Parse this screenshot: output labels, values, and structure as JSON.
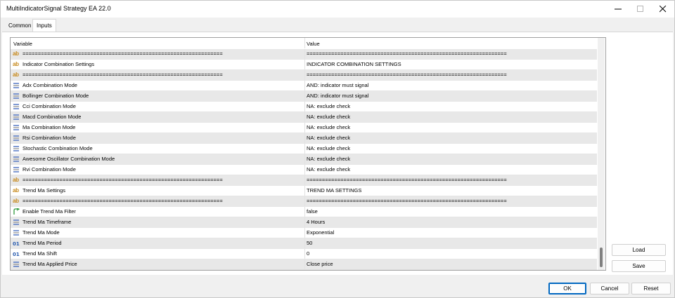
{
  "window": {
    "title": "MultiIndicatorSignal Strategy EA 22.0"
  },
  "tabs": [
    {
      "label": "Common"
    },
    {
      "label": "Inputs"
    }
  ],
  "grid": {
    "headers": {
      "variable": "Variable",
      "value": "Value"
    },
    "rows": [
      {
        "icon": "ab-icon",
        "variable": "=================================================================",
        "value": "================================================================="
      },
      {
        "icon": "ab-icon",
        "variable": "Indicator Combination Settings",
        "value": "INDICATOR COMBINATION SETTINGS"
      },
      {
        "icon": "ab-icon",
        "variable": "=================================================================",
        "value": "================================================================="
      },
      {
        "icon": "enum-icon",
        "variable": "Adx Combination Mode",
        "value": "AND: indicator must signal"
      },
      {
        "icon": "enum-icon",
        "variable": "Bollinger Combination Mode",
        "value": "AND: indicator must signal"
      },
      {
        "icon": "enum-icon",
        "variable": "Cci Combination Mode",
        "value": "NA: exclude check"
      },
      {
        "icon": "enum-icon",
        "variable": "Macd Combination Mode",
        "value": "NA: exclude check"
      },
      {
        "icon": "enum-icon",
        "variable": "Ma Combination Mode",
        "value": "NA: exclude check"
      },
      {
        "icon": "enum-icon",
        "variable": "Rsi Combination Mode",
        "value": "NA: exclude check"
      },
      {
        "icon": "enum-icon",
        "variable": "Stochastic Combination Mode",
        "value": "NA: exclude check"
      },
      {
        "icon": "enum-icon",
        "variable": "Awesome Oscillator Combination Mode",
        "value": "NA: exclude check"
      },
      {
        "icon": "enum-icon",
        "variable": "Rvi Combination Mode",
        "value": "NA: exclude check"
      },
      {
        "icon": "ab-icon",
        "variable": "=================================================================",
        "value": "================================================================="
      },
      {
        "icon": "ab-icon",
        "variable": "Trend Ma Settings",
        "value": "TREND MA SETTINGS"
      },
      {
        "icon": "ab-icon",
        "variable": "=================================================================",
        "value": "================================================================="
      },
      {
        "icon": "bool-icon",
        "variable": "Enable Trend Ma Filter",
        "value": "false"
      },
      {
        "icon": "enum-icon",
        "variable": "Trend Ma Timeframe",
        "value": "4 Hours"
      },
      {
        "icon": "enum-icon",
        "variable": "Trend Ma Mode",
        "value": "Exponential"
      },
      {
        "icon": "int-icon",
        "variable": "Trend Ma Period",
        "value": "50"
      },
      {
        "icon": "int-icon",
        "variable": "Trend Ma Shift",
        "value": "0"
      },
      {
        "icon": "enum-icon",
        "variable": "Trend Ma Applied Price",
        "value": "Close price"
      }
    ]
  },
  "side_buttons": {
    "load": "Load",
    "save": "Save"
  },
  "footer_buttons": {
    "ok": "OK",
    "cancel": "Cancel",
    "reset": "Reset"
  },
  "colors": {
    "accent": "#0067c0",
    "row_alt": "#e8e8e8",
    "ab_icon": "#c7891b",
    "enum_icon": "#4a6fc0",
    "bool_icon": "#2e9a3c",
    "int_icon": "#2a5db0"
  }
}
